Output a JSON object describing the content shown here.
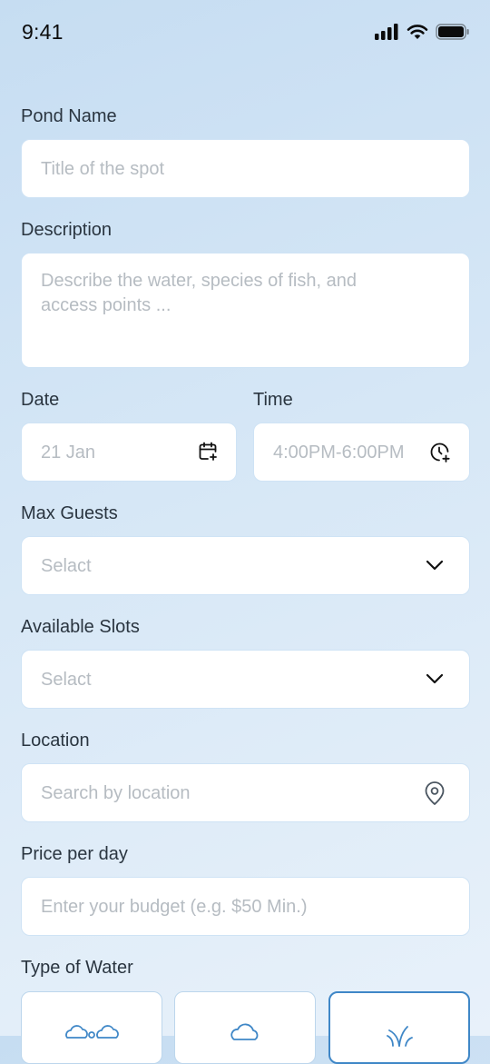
{
  "status_bar": {
    "time": "9:41",
    "icons": [
      "signal-icon",
      "wifi-icon",
      "battery-icon"
    ]
  },
  "form": {
    "pond_name": {
      "label": "Pond Name",
      "placeholder": "Title of the spot"
    },
    "description": {
      "label": "Description",
      "placeholder": "Describe the water, species of fish, and access points ..."
    },
    "date": {
      "label": "Date",
      "value": "21 Jan",
      "icon": "calendar-add-icon"
    },
    "time": {
      "label": "Time",
      "value": "4:00PM-6:00PM",
      "icon": "clock-add-icon"
    },
    "max_guests": {
      "label": "Max Guests",
      "placeholder": "Selact",
      "icon": "chevron-down-icon"
    },
    "available_slots": {
      "label": "Available Slots",
      "placeholder": "Selact",
      "icon": "chevron-down-icon"
    },
    "location": {
      "label": "Location",
      "placeholder": "Search by location",
      "icon": "location-pin-icon"
    },
    "price": {
      "label": "Price per day",
      "placeholder": "Enter your budget (e.g. $50 Min.)"
    },
    "water_type": {
      "label": "Type of Water",
      "options": [
        {
          "icon": "clouds-icon",
          "selected": false
        },
        {
          "icon": "cloud-icon",
          "selected": false
        },
        {
          "icon": "plant-icon",
          "selected": true
        }
      ]
    }
  },
  "colors": {
    "accent": "#3f87c7",
    "input_border": "#cfe3f5",
    "placeholder": "#b6bcc2"
  }
}
